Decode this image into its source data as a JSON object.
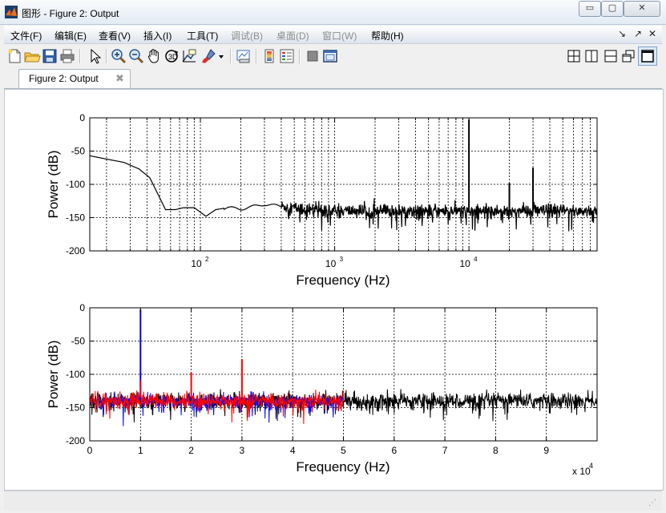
{
  "window": {
    "title": "图形 - Figure 2: Output",
    "minimize_glyph": "▭",
    "maximize_glyph": "▢",
    "close_glyph": "✕"
  },
  "menu": {
    "items": [
      {
        "label": "文件(F)",
        "enabled": true
      },
      {
        "label": "编辑(E)",
        "enabled": true
      },
      {
        "label": "查看(V)",
        "enabled": true
      },
      {
        "label": "插入(I)",
        "enabled": true
      },
      {
        "label": "工具(T)",
        "enabled": true
      },
      {
        "label": "调试(B)",
        "enabled": false
      },
      {
        "label": "桌面(D)",
        "enabled": false
      },
      {
        "label": "窗口(W)",
        "enabled": false
      },
      {
        "label": "帮助(H)",
        "enabled": true
      }
    ],
    "right_glyphs": [
      "↘",
      "↗",
      "✕"
    ]
  },
  "toolbar": {
    "icons": [
      "new-figure-icon",
      "open-file-icon",
      "save-icon",
      "print-icon",
      "select-arrow-icon",
      "zoom-in-icon",
      "zoom-out-icon",
      "pan-hand-icon",
      "rotate-3d-icon",
      "data-cursor-icon",
      "brush-icon",
      "link-plot-icon",
      "colorbar-icon",
      "legend-icon",
      "hide-plot-tools-icon",
      "show-plot-tools-icon",
      "tile-icon",
      "split-vertical-icon",
      "split-horizontal-icon",
      "float-icon",
      "maximize-icon"
    ]
  },
  "tab": {
    "label": "Figure 2: Output",
    "close_glyph": "✖"
  },
  "colors": {
    "trace_black": "#000000",
    "trace_red": "#ff0000",
    "trace_blue": "#0000ff",
    "grid": "#000000"
  },
  "chart_data": [
    {
      "type": "line",
      "xscale": "log",
      "xlim": [
        15,
        90000
      ],
      "ylim": [
        -200,
        0
      ],
      "yticks": [
        0,
        -50,
        -100,
        -150,
        -200
      ],
      "xtick_labels": [
        {
          "base": "10",
          "exp": "2",
          "value": 100
        },
        {
          "base": "10",
          "exp": "3",
          "value": 1000
        },
        {
          "base": "10",
          "exp": "4",
          "value": 10000
        }
      ],
      "xlabel": "Frequency (Hz)",
      "ylabel": "Power (dB)",
      "grid": true,
      "series": [
        {
          "color": "#000000",
          "envelope": [
            [
              15,
              -57
            ],
            [
              20,
              -62
            ],
            [
              27,
              -67
            ],
            [
              35,
              -77
            ],
            [
              42,
              -90
            ],
            [
              55,
              -138
            ],
            [
              65,
              -138
            ],
            [
              75,
              -135
            ],
            [
              90,
              -135
            ],
            [
              110,
              -148
            ],
            [
              130,
              -138
            ],
            [
              160,
              -135
            ],
            [
              200,
              -137
            ],
            [
              300,
              -130
            ],
            [
              400,
              -133
            ],
            [
              500,
              -135
            ],
            [
              600,
              -138
            ],
            [
              800,
              -138
            ],
            [
              1000,
              -140
            ],
            [
              3000,
              -140
            ],
            [
              10000,
              -140
            ],
            [
              30000,
              -140
            ],
            [
              90000,
              -140
            ]
          ],
          "noise_start": 400,
          "noise_std": 5,
          "spikes": [
            {
              "x": 10000,
              "y": -3
            },
            {
              "x": 20000,
              "y": -98
            },
            {
              "x": 30000,
              "y": -75
            }
          ]
        }
      ]
    },
    {
      "type": "line",
      "xlim": [
        0,
        100000
      ],
      "ylim": [
        -200,
        0
      ],
      "yticks": [
        0,
        -50,
        -100,
        -150,
        -200
      ],
      "xticks": [
        0,
        10000,
        20000,
        30000,
        40000,
        50000,
        60000,
        70000,
        80000,
        90000
      ],
      "xtick_labels": [
        "0",
        "1",
        "2",
        "3",
        "4",
        "5",
        "6",
        "7",
        "8",
        "9"
      ],
      "x_multiplier": {
        "base": "x 10",
        "exp": "4"
      },
      "xlabel": "Frequency (Hz)",
      "ylabel": "Power (dB)",
      "grid": true,
      "series": [
        {
          "color": "#000000",
          "x_range": [
            0,
            100000
          ],
          "baseline": -140,
          "noise_std": 6
        },
        {
          "color": "#0000ff",
          "x_range": [
            0,
            50000
          ],
          "baseline": -140,
          "noise_std": 5,
          "spikes": [
            {
              "x": 10000,
              "y": -3
            }
          ]
        },
        {
          "color": "#ff0000",
          "x_range": [
            0,
            50000
          ],
          "baseline": -140,
          "noise_std": 6,
          "spikes": [
            {
              "x": 10000,
              "y": -110
            },
            {
              "x": 20000,
              "y": -97
            },
            {
              "x": 30000,
              "y": -77
            }
          ]
        }
      ]
    }
  ]
}
